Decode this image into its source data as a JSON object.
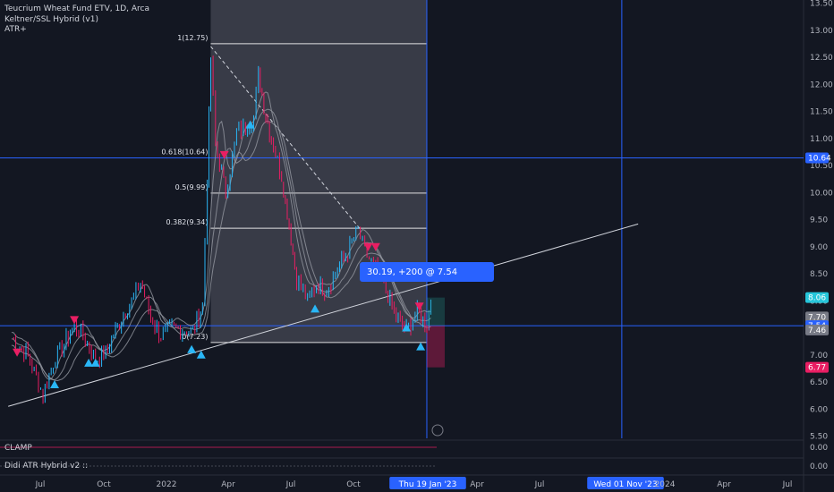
{
  "legend": {
    "title": "Teucrium Wheat Fund ETV, 1D, Arca",
    "indicator1": "Keltner/SSL Hybrid (v1)",
    "indicator2": "ATR+"
  },
  "subpanes": {
    "pane1_label": "CLAMP",
    "pane1_value": "0.00",
    "pane2_label": "Didi ATR Hybrid v2 ::",
    "pane2_value": "0.00"
  },
  "trade_label": "30.19, +200 @ 7.54",
  "colors": {
    "background": "#131722",
    "up": "#29b6f6",
    "down": "#e91e63",
    "price_line": "#2962ff",
    "fib_zone": "#5d606b"
  },
  "chart_data": {
    "type": "candlestick",
    "title": "Teucrium Wheat Fund ETV, 1D, Arca",
    "y_ticks": [
      "13.50",
      "13.00",
      "12.50",
      "12.00",
      "11.50",
      "11.00",
      "10.50",
      "10.00",
      "9.50",
      "9.00",
      "8.50",
      "8.00",
      "7.50",
      "7.00",
      "6.50",
      "6.00",
      "5.50"
    ],
    "ylim": [
      5.45,
      13.55
    ],
    "x_ticks": [
      "Jul",
      "Oct",
      "2022",
      "Apr",
      "Jul",
      "Oct",
      "Thu 19 Jan '23",
      "Apr",
      "Jul",
      "Wed 01 Nov '23",
      "2024",
      "Apr",
      "Jul"
    ],
    "price_path": [
      {
        "date": "2021-05-20",
        "close": 7.3
      },
      {
        "date": "2021-06-10",
        "close": 7.05
      },
      {
        "date": "2021-06-25",
        "close": 6.6
      },
      {
        "date": "2021-07-05",
        "close": 6.25
      },
      {
        "date": "2021-07-20",
        "close": 6.85
      },
      {
        "date": "2021-08-05",
        "close": 7.2
      },
      {
        "date": "2021-08-20",
        "close": 7.55
      },
      {
        "date": "2021-09-05",
        "close": 7.3
      },
      {
        "date": "2021-09-20",
        "close": 6.9
      },
      {
        "date": "2021-10-05",
        "close": 7.05
      },
      {
        "date": "2021-10-25",
        "close": 7.6
      },
      {
        "date": "2021-11-15",
        "close": 8.05
      },
      {
        "date": "2021-11-25",
        "close": 8.35
      },
      {
        "date": "2021-12-10",
        "close": 7.7
      },
      {
        "date": "2021-12-25",
        "close": 7.35
      },
      {
        "date": "2022-01-10",
        "close": 7.5
      },
      {
        "date": "2022-02-10",
        "close": 7.45
      },
      {
        "date": "2022-02-24",
        "close": 7.9
      },
      {
        "date": "2022-03-03",
        "close": 10.3
      },
      {
        "date": "2022-03-08",
        "close": 12.5
      },
      {
        "date": "2022-03-15",
        "close": 10.9
      },
      {
        "date": "2022-03-30",
        "close": 10.0
      },
      {
        "date": "2022-04-15",
        "close": 11.1
      },
      {
        "date": "2022-04-28",
        "close": 11.2
      },
      {
        "date": "2022-05-10",
        "close": 11.4
      },
      {
        "date": "2022-05-17",
        "close": 12.2
      },
      {
        "date": "2022-05-25",
        "close": 11.6
      },
      {
        "date": "2022-06-05",
        "close": 11.0
      },
      {
        "date": "2022-06-20",
        "close": 10.3
      },
      {
        "date": "2022-07-01",
        "close": 9.4
      },
      {
        "date": "2022-07-12",
        "close": 8.4
      },
      {
        "date": "2022-07-28",
        "close": 8.0
      },
      {
        "date": "2022-08-10",
        "close": 8.3
      },
      {
        "date": "2022-08-25",
        "close": 8.2
      },
      {
        "date": "2022-09-10",
        "close": 8.6
      },
      {
        "date": "2022-09-25",
        "close": 8.9
      },
      {
        "date": "2022-10-10",
        "close": 9.3
      },
      {
        "date": "2022-10-20",
        "close": 8.9
      },
      {
        "date": "2022-11-05",
        "close": 8.6
      },
      {
        "date": "2022-11-20",
        "close": 8.2
      },
      {
        "date": "2022-12-05",
        "close": 7.7
      },
      {
        "date": "2022-12-20",
        "close": 7.45
      },
      {
        "date": "2023-01-05",
        "close": 7.8
      },
      {
        "date": "2023-01-19",
        "close": 7.55
      },
      {
        "date": "2023-01-25",
        "close": 7.95
      }
    ],
    "fibonacci": [
      {
        "level": "1(12.75)",
        "value": 12.75
      },
      {
        "level": "0.618(10.64)",
        "value": 10.64
      },
      {
        "level": "0.5(9.99)",
        "value": 9.99
      },
      {
        "level": "0.382(9.34)",
        "value": 9.34
      },
      {
        "level": "0(7.23)",
        "value": 7.23
      }
    ],
    "fib_range": {
      "start": "2022-03-08",
      "end": "2023-01-19"
    },
    "trendline": {
      "start": {
        "date": "2021-05-15",
        "value": 6.05
      },
      "end": {
        "date": "2023-11-25",
        "value": 9.42
      }
    },
    "diagonal": {
      "start": {
        "date": "2022-03-08",
        "value": 12.7
      },
      "end": {
        "date": "2022-10-15",
        "value": 9.3
      }
    },
    "hlines": [
      10.64,
      7.54
    ],
    "vlines": [
      "2023-01-19",
      "2023-11-01"
    ],
    "price_labels": [
      {
        "text": "10.64",
        "value": 10.64,
        "color": "#2962ff"
      },
      {
        "text": "8.06",
        "value": 8.06,
        "color": "#26c6da"
      },
      {
        "text": "7.70",
        "value": 7.7,
        "color": "#787b86"
      },
      {
        "text": "7.54",
        "value": 7.54,
        "color": "#2962ff"
      },
      {
        "text": "7.46",
        "value": 7.46,
        "color": "#787b86"
      },
      {
        "text": "6.77",
        "value": 6.77,
        "color": "#e91e63"
      }
    ],
    "signals_up": [
      {
        "date": "2021-07-22",
        "value": 6.45
      },
      {
        "date": "2021-09-10",
        "value": 6.85
      },
      {
        "date": "2021-09-20",
        "value": 6.85
      },
      {
        "date": "2022-02-08",
        "value": 7.1
      },
      {
        "date": "2022-02-22",
        "value": 7.0
      },
      {
        "date": "2022-05-05",
        "value": 11.25
      },
      {
        "date": "2022-08-08",
        "value": 7.85
      },
      {
        "date": "2022-12-20",
        "value": 7.5
      },
      {
        "date": "2023-01-10",
        "value": 7.15
      }
    ],
    "signals_down": [
      {
        "date": "2021-05-28",
        "value": 7.05
      },
      {
        "date": "2021-08-20",
        "value": 7.65
      },
      {
        "date": "2022-03-28",
        "value": 10.7
      },
      {
        "date": "2022-10-25",
        "value": 9.0
      },
      {
        "date": "2022-11-05",
        "value": 9.0
      },
      {
        "date": "2023-01-08",
        "value": 7.9
      }
    ]
  }
}
